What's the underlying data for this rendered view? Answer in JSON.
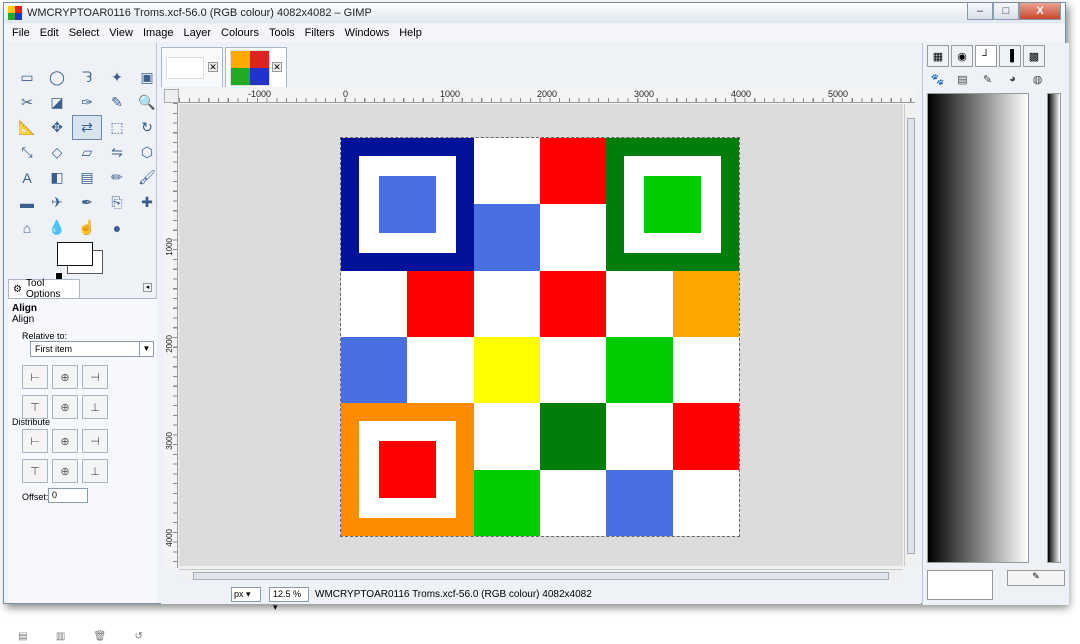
{
  "window": {
    "title": "WMCRYPTOAR0116 Troms.xcf-56.0 (RGB colour) 4082x4082 – GIMP",
    "controls": {
      "minimize": "–",
      "maximize": "□",
      "close": "X"
    }
  },
  "menu": [
    "File",
    "Edit",
    "Select",
    "View",
    "Image",
    "Layer",
    "Colours",
    "Tools",
    "Filters",
    "Windows",
    "Help"
  ],
  "toolbox": {
    "tool_icons": [
      "rect-select-icon",
      "ellipse-select-icon",
      "free-select-icon",
      "fuzzy-select-icon",
      "color-select-icon",
      "scissors-select-icon",
      "foreground-select-icon",
      "paths-icon",
      "color-picker-icon",
      "zoom-icon",
      "measure-icon",
      "move-icon",
      "align-icon",
      "transform-icon",
      "rotate-icon",
      "scale-icon",
      "shear-icon",
      "perspective-icon",
      "flip-icon",
      "cage-icon",
      "text-icon",
      "bucket-fill-icon",
      "blend-icon",
      "pencil-icon",
      "paintbrush-icon",
      "eraser-icon",
      "airbrush-icon",
      "ink-icon",
      "clone-icon",
      "heal-icon",
      "perspective-clone-icon",
      "blur-icon",
      "smudge-icon",
      "dodge-burn-icon"
    ],
    "tool_glyphs": [
      "▭",
      "◯",
      "ᘊ",
      "✦",
      "▣",
      "✂",
      "◪",
      "✑",
      "✎",
      "🔍",
      "📐",
      "✥",
      "⇄",
      "⬚",
      "↻",
      "⤡",
      "◇",
      "▱",
      "⇋",
      "⬡",
      "A",
      "◧",
      "▤",
      "✏",
      "🖌",
      "▬",
      "✈",
      "✒",
      "⎘",
      "✚",
      "⌂",
      "💧",
      "☝",
      "●"
    ],
    "active_index": 12
  },
  "tool_options": {
    "tab_label": "Tool Options",
    "heading": "Align",
    "subheading": "Align",
    "relative_to_label": "Relative to:",
    "relative_to_value": "First item",
    "distribute_label": "Distribute",
    "offset_label": "Offset:",
    "offset_value": "0"
  },
  "image_tabs": [
    {
      "name": "blank-image"
    },
    {
      "name": "troms-image",
      "active": true
    }
  ],
  "ruler": {
    "h_labels": [
      "-1000",
      "0",
      "1000",
      "2000",
      "3000",
      "4000",
      "5000"
    ],
    "v_labels": [
      "1000",
      "2000",
      "3000",
      "4000"
    ]
  },
  "statusbar": {
    "unit": "px",
    "zoom": "12.5 %",
    "text": "WMCRYPTOAR0116 Troms.xcf-56.0 (RGB colour) 4082x4082"
  },
  "colors": {
    "navy": "#00119a",
    "blue": "#4a6fe0",
    "red": "#ff0000",
    "dkgreen": "#007d0b",
    "green": "#00cc00",
    "orange": "#ff8c00",
    "amber": "#ffa500",
    "yellow": "#ffff00",
    "white": "#ffffff"
  },
  "board_cells": [
    [
      "W",
      "W",
      "W",
      "R",
      "W",
      "W"
    ],
    [
      "W",
      "W",
      "B",
      "W",
      "W",
      "W"
    ],
    [
      "W",
      "R",
      "W",
      "R",
      "W",
      "A"
    ],
    [
      "B",
      "W",
      "Y",
      "W",
      "G",
      "W"
    ],
    [
      "W",
      "W",
      "W",
      "D",
      "W",
      "R"
    ],
    [
      "W",
      "W",
      "G",
      "W",
      "B",
      "W"
    ]
  ],
  "corner_squares": [
    {
      "outer": "navy",
      "inner": "blue",
      "pos": "top-left"
    },
    {
      "outer": "dkgreen",
      "inner": "green",
      "pos": "top-right"
    },
    {
      "outer": "orange",
      "inner": "red",
      "pos": "bottom-left"
    }
  ]
}
